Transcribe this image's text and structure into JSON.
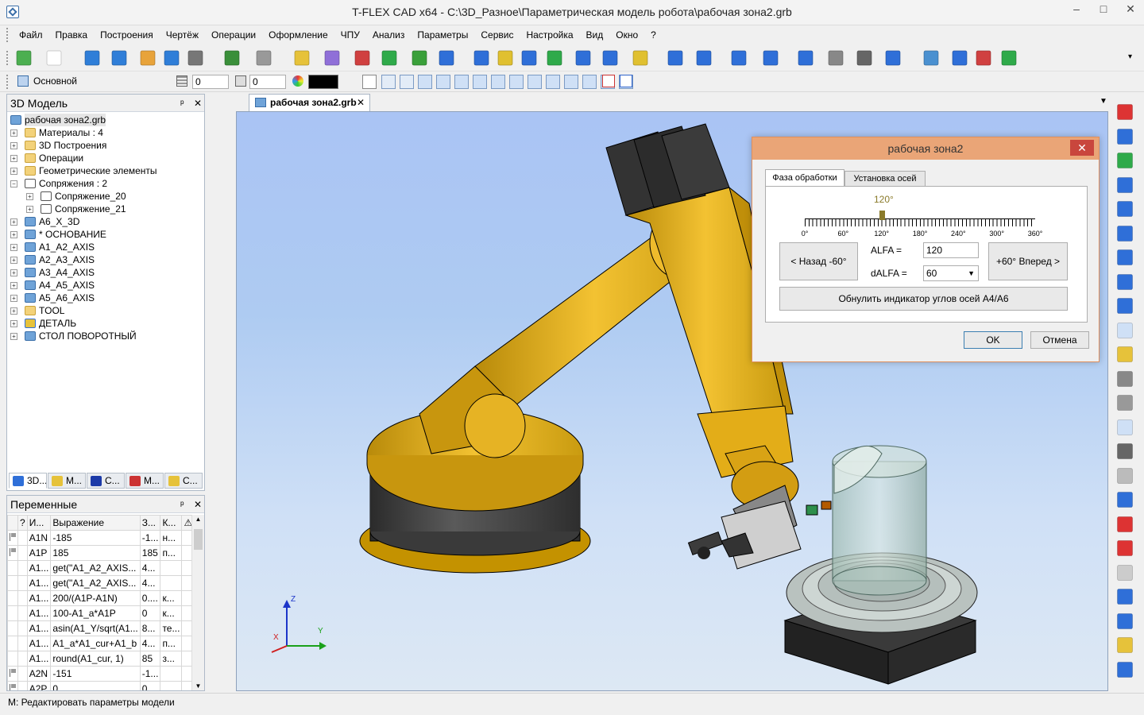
{
  "window": {
    "title": "T-FLEX CAD x64 - C:\\3D_Разное\\Параметрическая модель робота\\рабочая зона2.grb",
    "min": "–",
    "max": "□",
    "close": "✕"
  },
  "menu": [
    "Файл",
    "Правка",
    "Построения",
    "Чертёж",
    "Операции",
    "Оформление",
    "ЧПУ",
    "Анализ",
    "Параметры",
    "Сервис",
    "Настройка",
    "Вид",
    "Окно",
    "?"
  ],
  "toolbar2": {
    "layer": "Основной",
    "level_value": "0",
    "priority_value": "0"
  },
  "model_panel": {
    "title": "3D Модель",
    "pin": "ᵖ",
    "close": "✕",
    "tree": [
      {
        "label": "рабочая зона2.grb",
        "depth": 0,
        "icon": "cube",
        "expander": ""
      },
      {
        "label": "Материалы : 4",
        "depth": 1,
        "icon": "folder",
        "expander": "+"
      },
      {
        "label": "3D Построения",
        "depth": 1,
        "icon": "folder",
        "expander": "+"
      },
      {
        "label": "Операции",
        "depth": 1,
        "icon": "folder",
        "expander": "+"
      },
      {
        "label": "Геометрические элементы",
        "depth": 1,
        "icon": "folder",
        "expander": "+"
      },
      {
        "label": "Сопряжения : 2",
        "depth": 1,
        "icon": "mate",
        "expander": "−"
      },
      {
        "label": "Сопряжение_20",
        "depth": 2,
        "icon": "mate",
        "expander": "+"
      },
      {
        "label": "Сопряжение_21",
        "depth": 2,
        "icon": "mate",
        "expander": "+"
      },
      {
        "label": "A6_X_3D",
        "depth": 1,
        "icon": "cube",
        "expander": "+"
      },
      {
        "label": "* ОСНОВАНИЕ",
        "depth": 1,
        "icon": "cube",
        "expander": "+"
      },
      {
        "label": "A1_A2_AXIS",
        "depth": 1,
        "icon": "cube",
        "expander": "+"
      },
      {
        "label": "A2_A3_AXIS",
        "depth": 1,
        "icon": "cube",
        "expander": "+"
      },
      {
        "label": "A3_A4_AXIS",
        "depth": 1,
        "icon": "cube",
        "expander": "+"
      },
      {
        "label": "A4_A5_AXIS",
        "depth": 1,
        "icon": "cube",
        "expander": "+"
      },
      {
        "label": "A5_A6_AXIS",
        "depth": 1,
        "icon": "cube",
        "expander": "+"
      },
      {
        "label": "TOOL",
        "depth": 1,
        "icon": "folder",
        "expander": "+"
      },
      {
        "label": "ДЕТАЛЬ",
        "depth": 1,
        "icon": "part",
        "expander": "+"
      },
      {
        "label": "СТОЛ ПОВОРОТНЫЙ",
        "depth": 1,
        "icon": "cube",
        "expander": "+"
      }
    ],
    "bottom_tabs": [
      "3D...",
      "M...",
      "C...",
      "M...",
      "C..."
    ]
  },
  "vars_panel": {
    "title": "Переменные",
    "pin": "ᵖ",
    "close": "✕",
    "columns": [
      "",
      "?",
      "И...",
      "Выражение",
      "З...",
      "К...",
      "⚠"
    ],
    "rows": [
      {
        "flag": true,
        "name": "A1N",
        "expr": "-185",
        "val": "-1...",
        "comment": "н..."
      },
      {
        "flag": true,
        "name": "A1P",
        "expr": "185",
        "val": "185",
        "comment": "п..."
      },
      {
        "flag": false,
        "name": "A1...",
        "expr": "get(\"A1_A2_AXIS...",
        "val": "4...",
        "comment": ""
      },
      {
        "flag": false,
        "name": "A1...",
        "expr": "get(\"A1_A2_AXIS...",
        "val": "4...",
        "comment": ""
      },
      {
        "flag": false,
        "name": "A1...",
        "expr": "200/(A1P-A1N)",
        "val": "0....",
        "comment": "к..."
      },
      {
        "flag": false,
        "name": "A1...",
        "expr": "100-A1_a*A1P",
        "val": "0",
        "comment": "к..."
      },
      {
        "flag": false,
        "name": "A1...",
        "expr": "asin(A1_Y/sqrt(A1...",
        "val": "8...",
        "comment": "те..."
      },
      {
        "flag": false,
        "name": "A1...",
        "expr": "A1_a*A1_cur+A1_b",
        "val": "4...",
        "comment": "п..."
      },
      {
        "flag": false,
        "name": "A1...",
        "expr": "round(A1_cur, 1)",
        "val": "85",
        "comment": "з..."
      },
      {
        "flag": true,
        "name": "A2N",
        "expr": "-151",
        "val": "-1...",
        "comment": ""
      },
      {
        "flag": true,
        "name": "A2P",
        "expr": "0",
        "val": "0",
        "comment": ""
      }
    ]
  },
  "document_tab": {
    "label": "рабочая зона2.grb",
    "close": "✕"
  },
  "axes": {
    "x": "X",
    "y": "Y",
    "z": "Z"
  },
  "dialog": {
    "title": "рабочая зона2",
    "close": "✕",
    "tabs": [
      "Фаза обработки",
      "Установка осей"
    ],
    "scale_value_label": "120°",
    "scale_ticks": [
      "0°",
      "60°",
      "120°",
      "180°",
      "240°",
      "300°",
      "360°"
    ],
    "slider_fraction": 0.333,
    "back_button": "< Назад -60°",
    "forward_button": "+60° Вперед >",
    "alfa_label": "ALFA =",
    "alfa_value": "120",
    "dalfa_label": "dALFA =",
    "dalfa_value": "60",
    "reset_button": "Обнулить индикатор углов осей A4/A6",
    "ok_button": "OK",
    "cancel_button": "Отмена"
  },
  "status": {
    "text": "M: Редактировать параметры модели"
  }
}
